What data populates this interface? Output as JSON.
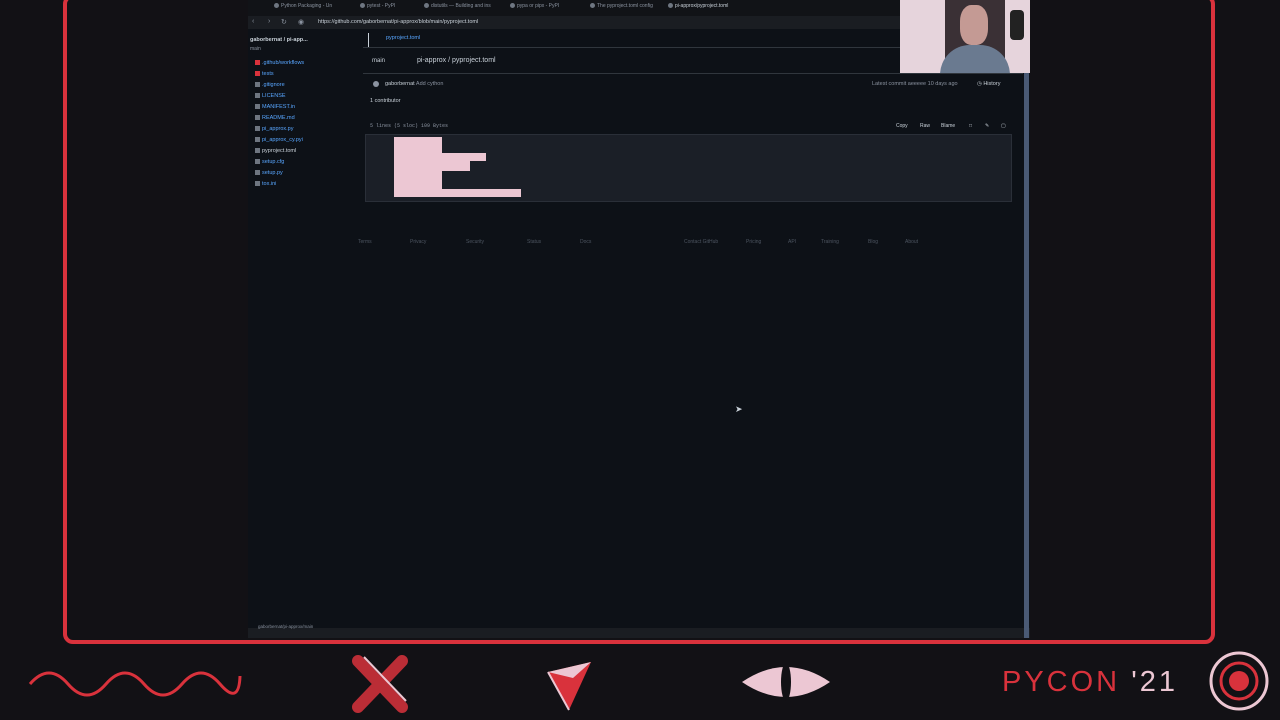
{
  "browser": {
    "tabs": [
      "Python Packaging - Un",
      "pytest - PyPI",
      "distutils — Building and ins",
      "pypa or pipx - PyPI",
      "The pyproject.toml config",
      "pi-approx/pyproject.toml"
    ],
    "url": "https://github.com/gaborbernat/pi-approx/blob/main/pyproject.toml"
  },
  "sidebar": {
    "repo": "gaborbernat / pi-app...",
    "branch": "main",
    "files": [
      ".github/workflows",
      "tests",
      ".gitignore",
      "LICENSE",
      "MANIFEST.in",
      "README.md",
      "pi_approx.py",
      "pi_approx_cy.pyi",
      "pyproject.toml",
      "setup.cfg",
      "setup.py",
      "tox.ini"
    ]
  },
  "main": {
    "open_tab": "pyproject.toml",
    "branch_label": "main",
    "path": "pi-approx / pyproject.toml",
    "commit_author": "gaborbernat",
    "commit_message": "Add cython",
    "latest_commit": "Latest commit aeeeee 10 days ago",
    "history_label": "History",
    "contributors": "1 contributor",
    "file_info": "5 lines (5 sloc)  109 Bytes",
    "actions": [
      "Copy",
      "Raw",
      "Blame"
    ]
  },
  "footer_links": [
    "Terms",
    "Privacy",
    "Security",
    "Status",
    "Docs",
    "Contact GitHub",
    "Pricing",
    "API",
    "Training",
    "Blog",
    "About"
  ],
  "status_bar": "gaborbernat/pi-approx/main",
  "branding": {
    "event": "PYCON",
    "year": "'21",
    "accent_color": "#d9323c",
    "secondary_color": "#ecc7d3",
    "icons": [
      "wave-icon",
      "cross-icon",
      "triangle-icon",
      "eye-icon",
      "circle-logo-icon"
    ]
  }
}
